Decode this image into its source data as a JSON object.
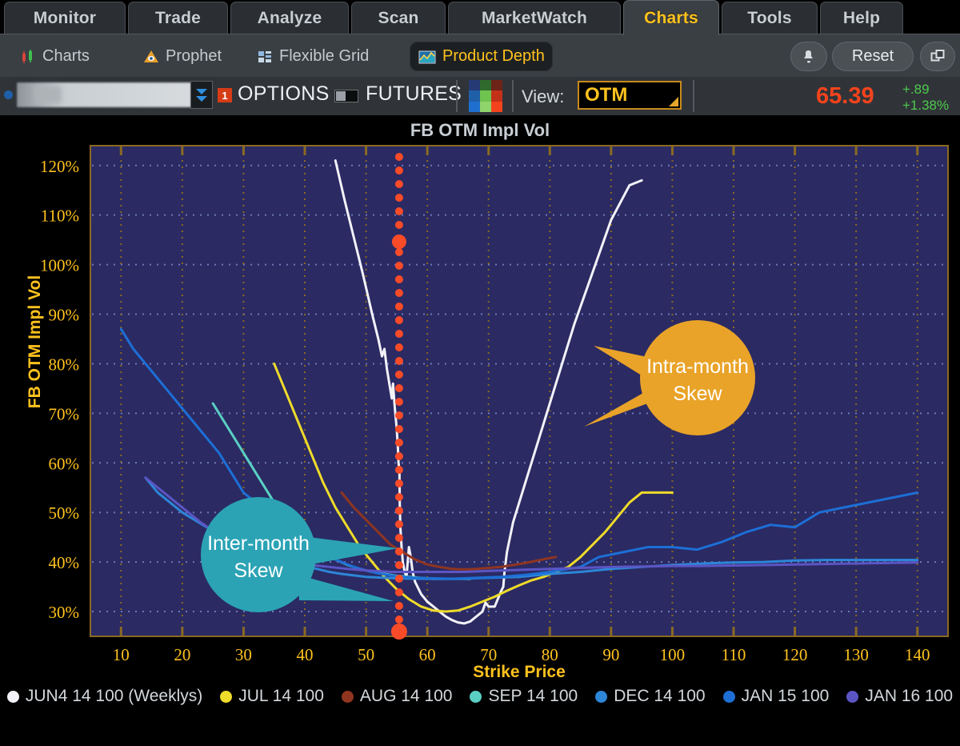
{
  "colors": {
    "plot_bg": "#2b2a63",
    "axis_label": "#ffc21e",
    "vgrid": "#8a6a22",
    "hgrid": "#7a86c8",
    "marker_line": "#fa4b28",
    "accent_orange": "#e9a328",
    "accent_teal": "#2ba3b5",
    "price_up": "#4ec94e",
    "price": "#f4431c"
  },
  "tabs": [
    {
      "label": "Monitor",
      "active": false
    },
    {
      "label": "Trade",
      "active": false
    },
    {
      "label": "Analyze",
      "active": false
    },
    {
      "label": "Scan",
      "active": false
    },
    {
      "label": "MarketWatch",
      "active": false
    },
    {
      "label": "Charts",
      "active": true
    },
    {
      "label": "Tools",
      "active": false
    },
    {
      "label": "Help",
      "active": false
    }
  ],
  "subbar": {
    "items": [
      {
        "label": "Charts",
        "icon": "candlestick-icon",
        "selected": false
      },
      {
        "label": "Prophet",
        "icon": "pyramid-eye-icon",
        "selected": false
      },
      {
        "label": "Flexible Grid",
        "icon": "grid-layout-icon",
        "selected": false
      },
      {
        "label": "Product Depth",
        "icon": "area-chart-icon",
        "selected": true
      }
    ],
    "alert_icon": "bell-icon",
    "reset_label": "Reset",
    "detach_icon": "detach-window-icon"
  },
  "quoterow": {
    "symbol_value": "",
    "symbol_placeholder": "",
    "dropdown_icon": "chevron-down-icon",
    "badge": "1",
    "options_label": "OPTIONS",
    "futures_label": "FUTURES",
    "toggle_state": "options",
    "palette_icon": "color-palette-icon",
    "palette_swatches": [
      "#253a76",
      "#2e6b2c",
      "#6d2318",
      "#1f5fa8",
      "#6fc44f",
      "#c23118",
      "#1f6fd0",
      "#8fd46b",
      "#f4431c"
    ],
    "view_label": "View:",
    "view_value": "OTM",
    "price": "65.39",
    "change_abs": "+.89",
    "change_pct": "+1.38%"
  },
  "chart_data": {
    "type": "line",
    "title": "FB OTM Impl Vol",
    "xlabel": "Strike Price",
    "ylabel": "FB OTM Impl Vol",
    "xlim": [
      5,
      145
    ],
    "ylim": [
      25,
      124
    ],
    "xticks": [
      10,
      20,
      30,
      40,
      50,
      60,
      70,
      80,
      90,
      100,
      110,
      120,
      130,
      140
    ],
    "yticks": [
      30,
      40,
      50,
      60,
      70,
      80,
      90,
      100,
      110,
      120
    ],
    "ytick_labels": [
      "30%",
      "40%",
      "50%",
      "60%",
      "70%",
      "80%",
      "90%",
      "100%",
      "110%",
      "120%"
    ],
    "grid": true,
    "legend_position": "bottom",
    "marker_line": {
      "x": 55.4,
      "label": "",
      "style": "dotted",
      "color": "#fa4b28"
    },
    "series": [
      {
        "name": "JUN4 14 100 (Weeklys)",
        "color": "#f2f2f8",
        "points": [
          [
            45,
            121
          ],
          [
            46.5,
            113
          ],
          [
            48,
            105.5
          ],
          [
            49.5,
            98
          ],
          [
            51,
            90
          ],
          [
            52,
            85
          ],
          [
            52.6,
            81.5
          ],
          [
            53,
            83
          ],
          [
            53.4,
            79
          ],
          [
            53.8,
            76
          ],
          [
            54.2,
            73
          ],
          [
            54.4,
            76
          ],
          [
            54.7,
            71
          ],
          [
            55,
            67
          ],
          [
            55.2,
            63
          ],
          [
            55.3,
            60
          ],
          [
            55.45,
            58.5
          ],
          [
            55.5,
            52
          ],
          [
            55.6,
            47
          ],
          [
            55.8,
            43
          ],
          [
            56,
            40
          ],
          [
            56.3,
            38
          ],
          [
            56.6,
            37
          ],
          [
            57,
            43
          ],
          [
            57.3,
            41
          ],
          [
            57.6,
            38
          ],
          [
            58,
            36
          ],
          [
            59,
            33.5
          ],
          [
            60,
            32
          ],
          [
            61,
            31
          ],
          [
            62,
            30
          ],
          [
            63,
            29
          ],
          [
            64,
            28.3
          ],
          [
            65,
            27.8
          ],
          [
            66,
            27.6
          ],
          [
            67,
            28
          ],
          [
            68,
            29
          ],
          [
            69,
            30
          ],
          [
            69.5,
            31.8
          ],
          [
            70,
            31
          ],
          [
            71,
            31
          ],
          [
            72,
            34
          ],
          [
            72.4,
            35
          ],
          [
            72.6,
            38
          ],
          [
            73,
            42
          ],
          [
            74,
            48
          ],
          [
            76,
            56
          ],
          [
            78,
            64
          ],
          [
            80,
            72
          ],
          [
            82,
            80
          ],
          [
            84,
            88
          ],
          [
            86,
            95
          ],
          [
            88,
            102
          ],
          [
            90,
            109
          ],
          [
            93,
            116
          ],
          [
            95,
            117
          ]
        ]
      },
      {
        "name": "JUL 14 100",
        "color": "#eedb2a",
        "points": [
          [
            35,
            80
          ],
          [
            37,
            74
          ],
          [
            39,
            68
          ],
          [
            41,
            62
          ],
          [
            43,
            56
          ],
          [
            45,
            51
          ],
          [
            47,
            47
          ],
          [
            49,
            43
          ],
          [
            51,
            40
          ],
          [
            53,
            37
          ],
          [
            55,
            34.5
          ],
          [
            57,
            32.5
          ],
          [
            59,
            31
          ],
          [
            61,
            30.2
          ],
          [
            63,
            30
          ],
          [
            65,
            30.2
          ],
          [
            67,
            31
          ],
          [
            69,
            32
          ],
          [
            71,
            33
          ],
          [
            73,
            34.2
          ],
          [
            75,
            35.3
          ],
          [
            77,
            36.3
          ],
          [
            79,
            37
          ],
          [
            81,
            38
          ],
          [
            83,
            39
          ],
          [
            85,
            41
          ],
          [
            87,
            43.5
          ],
          [
            89,
            46
          ],
          [
            91,
            49
          ],
          [
            93,
            52
          ],
          [
            95,
            54
          ],
          [
            98,
            54
          ],
          [
            100,
            54
          ]
        ]
      },
      {
        "name": "AUG 14 100",
        "color": "#8f3520",
        "points": [
          [
            46,
            54
          ],
          [
            48,
            51
          ],
          [
            50,
            48.5
          ],
          [
            52,
            46
          ],
          [
            54,
            43.5
          ],
          [
            56,
            42
          ],
          [
            58,
            40.5
          ],
          [
            60,
            39.5
          ],
          [
            62,
            39
          ],
          [
            64,
            38.6
          ],
          [
            66,
            38.5
          ],
          [
            68,
            38.6
          ],
          [
            70,
            38.8
          ],
          [
            72,
            39
          ],
          [
            74,
            39.4
          ],
          [
            76,
            39.8
          ],
          [
            78,
            40.3
          ],
          [
            80,
            40.8
          ],
          [
            81,
            41
          ]
        ]
      },
      {
        "name": "SEP 14 100",
        "color": "#5ad0c4",
        "points": [
          [
            25,
            72
          ],
          [
            27,
            68
          ],
          [
            29,
            64
          ],
          [
            31,
            60
          ],
          [
            33,
            56
          ],
          [
            35,
            52
          ],
          [
            37,
            49
          ],
          [
            39,
            46
          ],
          [
            41,
            44
          ],
          [
            43,
            42
          ],
          [
            45,
            40.5
          ],
          [
            47,
            39.4
          ],
          [
            49,
            38.6
          ],
          [
            51,
            38
          ],
          [
            53,
            37.6
          ],
          [
            55,
            37.2
          ],
          [
            57,
            37
          ],
          [
            59,
            36.8
          ],
          [
            61,
            36.6
          ],
          [
            63,
            36.6
          ],
          [
            65,
            36.6
          ],
          [
            67,
            36.6
          ]
        ]
      },
      {
        "name": "DEC 14 100",
        "color": "#2d86d8",
        "points": [
          [
            14,
            57
          ],
          [
            16,
            54
          ],
          [
            18,
            52
          ],
          [
            20,
            50
          ],
          [
            22,
            48.5
          ],
          [
            24,
            47
          ],
          [
            26,
            45.5
          ],
          [
            28,
            44
          ],
          [
            30,
            43
          ],
          [
            32,
            42.5
          ],
          [
            34,
            42
          ],
          [
            36,
            41
          ],
          [
            38,
            40
          ],
          [
            40,
            39.2
          ],
          [
            42,
            38.6
          ],
          [
            44,
            38
          ],
          [
            46,
            37.6
          ],
          [
            48,
            37.3
          ],
          [
            50,
            37
          ],
          [
            55,
            36.7
          ],
          [
            60,
            36.6
          ],
          [
            65,
            36.6
          ],
          [
            70,
            36.8
          ],
          [
            75,
            37
          ],
          [
            80,
            37.6
          ],
          [
            85,
            38
          ],
          [
            90,
            38.6
          ],
          [
            95,
            39
          ],
          [
            100,
            39.4
          ],
          [
            105,
            39.7
          ],
          [
            110,
            39.9
          ],
          [
            115,
            40
          ],
          [
            120,
            40.3
          ],
          [
            125,
            40.4
          ],
          [
            130,
            40.4
          ],
          [
            135,
            40.4
          ],
          [
            140,
            40.4
          ]
        ]
      },
      {
        "name": "JAN 15 100",
        "color": "#1d6fd6",
        "points": [
          [
            10,
            87
          ],
          [
            12,
            83
          ],
          [
            14,
            80
          ],
          [
            16,
            77
          ],
          [
            18,
            74
          ],
          [
            20,
            71
          ],
          [
            22,
            68
          ],
          [
            24,
            65
          ],
          [
            26,
            62
          ],
          [
            28,
            58
          ],
          [
            30,
            54
          ],
          [
            32,
            52
          ],
          [
            34,
            50
          ],
          [
            36,
            47
          ],
          [
            38,
            45
          ],
          [
            40,
            43
          ],
          [
            42,
            42
          ],
          [
            44,
            41
          ],
          [
            46,
            40
          ],
          [
            48,
            39
          ],
          [
            50,
            38.3
          ],
          [
            52,
            37.7
          ],
          [
            55,
            37.1
          ],
          [
            58,
            36.8
          ],
          [
            61,
            36.7
          ],
          [
            64,
            36.6
          ],
          [
            68,
            36.8
          ],
          [
            72,
            37
          ],
          [
            76,
            37.4
          ],
          [
            80,
            38
          ],
          [
            85,
            39
          ],
          [
            88,
            41
          ],
          [
            92,
            42
          ],
          [
            96,
            43
          ],
          [
            100,
            43
          ],
          [
            104,
            42.5
          ],
          [
            108,
            44
          ],
          [
            112,
            46
          ],
          [
            116,
            47.5
          ],
          [
            120,
            47
          ],
          [
            124,
            50
          ],
          [
            128,
            51
          ],
          [
            132,
            52
          ],
          [
            136,
            53
          ],
          [
            140,
            54
          ]
        ]
      },
      {
        "name": "JAN 16 100",
        "color": "#5b55c4",
        "points": [
          [
            14,
            57
          ],
          [
            17,
            54
          ],
          [
            20,
            51
          ],
          [
            23,
            48
          ],
          [
            26,
            45.5
          ],
          [
            29,
            43.5
          ],
          [
            32,
            42
          ],
          [
            35,
            41
          ],
          [
            38,
            40
          ],
          [
            41,
            39.4
          ],
          [
            44,
            39
          ],
          [
            47,
            38.6
          ],
          [
            50,
            38.3
          ],
          [
            54,
            38
          ],
          [
            58,
            38
          ],
          [
            62,
            38
          ],
          [
            66,
            38
          ],
          [
            70,
            38.2
          ],
          [
            75,
            38.4
          ],
          [
            80,
            38.6
          ],
          [
            85,
            38.8
          ],
          [
            90,
            39
          ],
          [
            95,
            39.1
          ],
          [
            100,
            39.2
          ],
          [
            105,
            39.2
          ],
          [
            110,
            39.3
          ],
          [
            115,
            39.4
          ],
          [
            120,
            39.5
          ],
          [
            125,
            39.6
          ],
          [
            130,
            39.7
          ],
          [
            135,
            39.8
          ],
          [
            140,
            39.9
          ]
        ]
      }
    ],
    "annotations": [
      {
        "id": "intra-month-skew",
        "text_line1": "Intra-month",
        "text_line2": "Skew",
        "color": "#e9a328"
      },
      {
        "id": "inter-month-skew",
        "text_line1": "Inter-month",
        "text_line2": "Skew",
        "color": "#2ba3b5"
      }
    ]
  },
  "legend": [
    {
      "label": "JUN4 14 100 (Weeklys)",
      "color": "#f2f2f8"
    },
    {
      "label": "JUL 14 100",
      "color": "#eedb2a"
    },
    {
      "label": "AUG 14 100",
      "color": "#8f3520"
    },
    {
      "label": "SEP 14 100",
      "color": "#5ad0c4"
    },
    {
      "label": "DEC 14 100",
      "color": "#2d86d8"
    },
    {
      "label": "JAN 15 100",
      "color": "#1d6fd6"
    },
    {
      "label": "JAN 16 100",
      "color": "#5b55c4"
    }
  ]
}
